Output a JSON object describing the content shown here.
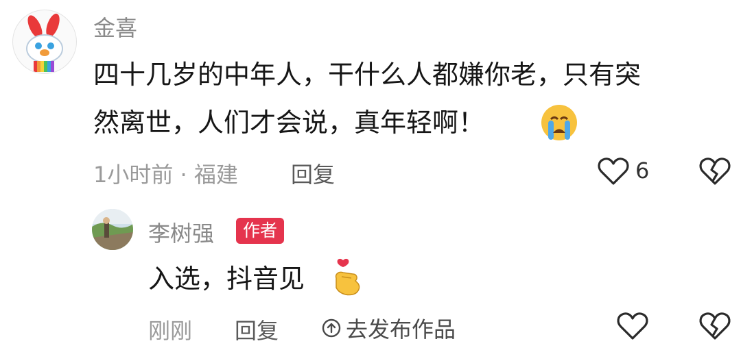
{
  "comment": {
    "author": "金喜",
    "text_line1": "四十几岁的中年人，干什么人都嫌你老，只有突",
    "text_line2": "然离世，人们才会说，真年轻啊！",
    "emoji": "crying-face-icon",
    "time_location": "1小时前 · 福建",
    "reply_label": "回复",
    "like_count": "6"
  },
  "reply": {
    "author": "李树强",
    "author_badge": "作者",
    "text": "入选，抖音见",
    "emoji": "finger-heart-icon",
    "time": "刚刚",
    "reply_label": "回复",
    "publish_label": "去发布作品"
  },
  "colors": {
    "badge_bg": "#e5344d",
    "name": "#8a8a8a",
    "meta": "#9a9a9a"
  }
}
